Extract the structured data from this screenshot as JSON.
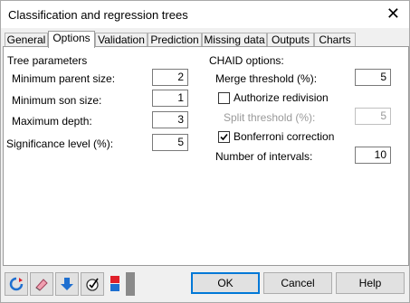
{
  "window": {
    "title": "Classification and regression trees",
    "close_glyph": "✕"
  },
  "tabs": [
    "General",
    "Options",
    "Validation",
    "Prediction",
    "Missing data",
    "Outputs",
    "Charts"
  ],
  "left": {
    "section": "Tree parameters",
    "min_parent_label": "Minimum parent size:",
    "min_parent_value": "2",
    "min_son_label": "Minimum son size:",
    "min_son_value": "1",
    "max_depth_label": "Maximum depth:",
    "max_depth_value": "3",
    "significance_label": "Significance level (%):",
    "significance_value": "5"
  },
  "chaid": {
    "section": "CHAID options:",
    "merge_label": "Merge threshold (%):",
    "merge_value": "5",
    "authorize_label": "Authorize redivision",
    "authorize_checked": false,
    "split_label": "Split threshold (%):",
    "split_value": "5",
    "bonferroni_label": "Bonferroni correction",
    "bonferroni_checked": true,
    "intervals_label": "Number of intervals:",
    "intervals_value": "10"
  },
  "buttons": {
    "ok": "OK",
    "cancel": "Cancel",
    "help": "Help"
  },
  "toolbar_icons": [
    "reset-icon",
    "eraser-icon",
    "download-arrow-icon",
    "check-tool-icon",
    "flag-icon",
    "panel-toggle-icon"
  ],
  "colors": {
    "accent": "#0078d7",
    "arrow_blue": "#1e6fd0",
    "flag_red": "#e0202a"
  }
}
